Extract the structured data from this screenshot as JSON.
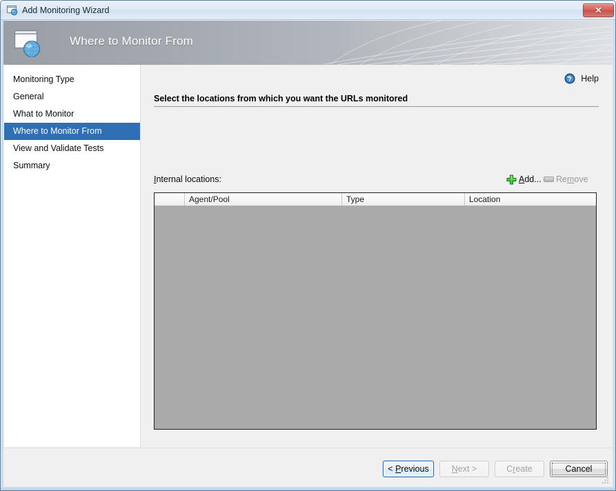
{
  "window": {
    "title": "Add Monitoring Wizard",
    "titlebar_icon": "window-globe-icon",
    "close_label": "✕"
  },
  "banner": {
    "title": "Where to Monitor From",
    "icon": "window-globe-icon"
  },
  "sidebar": {
    "items": [
      {
        "label": "Monitoring Type",
        "selected": false
      },
      {
        "label": "General",
        "selected": false
      },
      {
        "label": "What to Monitor",
        "selected": false
      },
      {
        "label": "Where to Monitor From",
        "selected": true
      },
      {
        "label": "View and Validate Tests",
        "selected": false
      },
      {
        "label": "Summary",
        "selected": false
      }
    ]
  },
  "content": {
    "help_label": "Help",
    "help_icon": "question-mark-circle-icon",
    "section_heading": "Select the locations from which you want the URLs monitored",
    "locations_label_prefix": "I",
    "locations_label_rest": "nternal locations:",
    "add": {
      "prefix": "",
      "accel": "A",
      "suffix": "dd...",
      "icon": "green-plus-icon",
      "enabled": true
    },
    "remove": {
      "prefix": "Re",
      "accel": "m",
      "suffix": "ove",
      "icon": "gray-bar-icon",
      "enabled": false
    },
    "grid": {
      "columns": [
        {
          "label": ""
        },
        {
          "label": "Agent/Pool"
        },
        {
          "label": "Type"
        },
        {
          "label": "Location"
        }
      ],
      "rows": []
    }
  },
  "footer": {
    "buttons": [
      {
        "id": "previous",
        "prefix": "< ",
        "accel": "P",
        "suffix": "revious",
        "enabled": true,
        "default": true
      },
      {
        "id": "next",
        "prefix": "",
        "accel": "N",
        "suffix": "ext >",
        "enabled": false,
        "default": false
      },
      {
        "id": "create",
        "prefix": "C",
        "accel": "r",
        "suffix": "eate",
        "enabled": false,
        "default": false
      },
      {
        "id": "cancel",
        "prefix": "Cancel",
        "accel": "",
        "suffix": "",
        "enabled": true,
        "default": false
      }
    ]
  },
  "colors": {
    "selection_blue": "#2f6fb5",
    "grid_body_gray": "#aaaaaa",
    "panel_gray": "#f0f0f0",
    "banner_gray": "#b2b7bd",
    "accent_green": "#34b233",
    "close_red": "#d5655c"
  }
}
